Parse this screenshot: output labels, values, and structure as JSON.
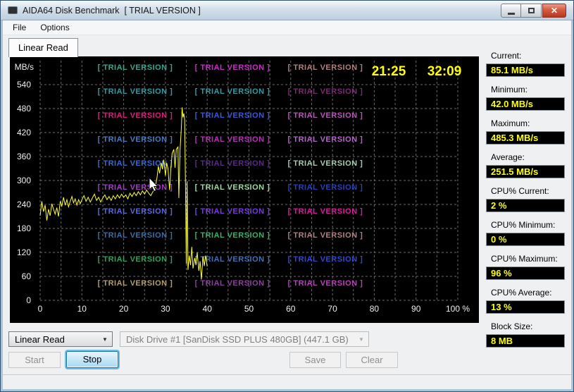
{
  "window": {
    "title": "AIDA64 Disk Benchmark  [ TRIAL VERSION ]"
  },
  "menu": {
    "items": [
      "File",
      "Options"
    ]
  },
  "tab": {
    "label": "Linear Read"
  },
  "chart_data": {
    "type": "line",
    "title": "",
    "ylabel": "MB/s",
    "xlabel": "",
    "ylim": [
      0,
      600
    ],
    "xlim": [
      0,
      100
    ],
    "y_ticks": [
      540,
      480,
      420,
      360,
      300,
      240,
      180,
      120,
      60,
      0
    ],
    "x_tick_labels": [
      "0",
      "10",
      "20",
      "30",
      "40",
      "50",
      "60",
      "70",
      "80",
      "90",
      "100 %"
    ],
    "x_grid_step_percent": 5,
    "grid": true,
    "legend": "none",
    "background": "#000000",
    "line_color": "#ffff2e",
    "elapsed_time": "21:25",
    "remaining_time": "32:09",
    "watermark_text": "[ TRIAL VERSION ]",
    "watermark_colors": [
      [
        "#38a88e",
        "#cc2acc",
        "#b57f7f"
      ],
      [
        "#2f9da5",
        "#2f9da5",
        "#7c2a72"
      ],
      [
        "#e01a7e",
        "#3a57d8",
        "#bb55bb"
      ],
      [
        "#4a7dc4",
        "#bb2ebb",
        "#b566c9"
      ],
      [
        "#3a6ad0",
        "#5a2a8a",
        "#a8ccb2"
      ],
      [
        "#a43cc9",
        "#9ed89e",
        "#2a3fbf"
      ],
      [
        "#5b68dd",
        "#7a3ae0",
        "#e018a0"
      ],
      [
        "#3e6da3",
        "#3cb06e",
        "#b08282"
      ],
      [
        "#2ca45c",
        "#4070b8",
        "#3347d2"
      ],
      [
        "#b3a06b",
        "#8f3f9f",
        "#bb3ebb"
      ]
    ],
    "series": [
      {
        "name": "Linear Read (MB/s)",
        "points": [
          [
            0,
            212
          ],
          [
            0.4,
            248
          ],
          [
            0.8,
            222
          ],
          [
            1.2,
            238
          ],
          [
            1.6,
            200
          ],
          [
            2,
            228
          ],
          [
            2.4,
            212
          ],
          [
            2.8,
            242
          ],
          [
            3.2,
            228
          ],
          [
            3.6,
            216
          ],
          [
            4,
            232
          ],
          [
            4.4,
            210
          ],
          [
            4.8,
            248
          ],
          [
            5.2,
            236
          ],
          [
            5.6,
            258
          ],
          [
            6,
            238
          ],
          [
            6.4,
            252
          ],
          [
            6.8,
            234
          ],
          [
            7.2,
            248
          ],
          [
            7.6,
            260
          ],
          [
            8,
            244
          ],
          [
            8.4,
            254
          ],
          [
            8.8,
            238
          ],
          [
            9.2,
            252
          ],
          [
            9.6,
            242
          ],
          [
            10,
            252
          ],
          [
            10.5,
            262
          ],
          [
            11,
            248
          ],
          [
            11.5,
            258
          ],
          [
            12,
            246
          ],
          [
            12.5,
            256
          ],
          [
            13,
            266
          ],
          [
            13.5,
            250
          ],
          [
            14,
            258
          ],
          [
            14.5,
            246
          ],
          [
            15,
            256
          ],
          [
            15.5,
            264
          ],
          [
            16,
            252
          ],
          [
            16.5,
            260
          ],
          [
            17,
            250
          ],
          [
            17.5,
            262
          ],
          [
            18,
            254
          ],
          [
            18.5,
            264
          ],
          [
            19,
            256
          ],
          [
            19.5,
            266
          ],
          [
            20,
            258
          ],
          [
            20.5,
            264
          ],
          [
            21,
            254
          ],
          [
            21.5,
            268
          ],
          [
            22,
            260
          ],
          [
            22.5,
            270
          ],
          [
            23,
            262
          ],
          [
            23.5,
            272
          ],
          [
            24,
            264
          ],
          [
            24.5,
            274
          ],
          [
            25,
            266
          ],
          [
            25.5,
            276
          ],
          [
            26,
            268
          ],
          [
            26.5,
            262
          ],
          [
            27,
            272
          ],
          [
            27.5,
            280
          ],
          [
            28,
            308
          ],
          [
            28.3,
            336
          ],
          [
            28.6,
            318
          ],
          [
            29,
            344
          ],
          [
            29.3,
            328
          ],
          [
            29.6,
            352
          ],
          [
            30,
            312
          ],
          [
            30.3,
            344
          ],
          [
            30.6,
            330
          ],
          [
            31,
            276
          ],
          [
            31.3,
            330
          ],
          [
            31.6,
            368
          ],
          [
            32,
            378
          ],
          [
            32.3,
            332
          ],
          [
            32.6,
            378
          ],
          [
            33,
            384
          ],
          [
            33.2,
            256
          ],
          [
            33.5,
            378
          ],
          [
            33.8,
            428
          ],
          [
            34,
            483
          ],
          [
            34.2,
            458
          ],
          [
            34.4,
            468
          ],
          [
            34.6,
            452
          ],
          [
            34.8,
            282
          ],
          [
            35,
            92
          ],
          [
            35.2,
            298
          ],
          [
            35.4,
            76
          ],
          [
            35.7,
            112
          ],
          [
            36,
            88
          ],
          [
            36.3,
            134
          ],
          [
            36.6,
            80
          ],
          [
            37,
            106
          ],
          [
            37.3,
            88
          ],
          [
            37.6,
            120
          ],
          [
            38,
            74
          ],
          [
            38.3,
            98
          ],
          [
            38.6,
            52
          ],
          [
            39,
            110
          ],
          [
            39.3,
            86
          ],
          [
            39.6,
            112
          ],
          [
            40,
            85
          ]
        ]
      }
    ]
  },
  "stats": [
    {
      "label": "Current:",
      "value": "85.1 MB/s"
    },
    {
      "label": "Minimum:",
      "value": "42.0 MB/s"
    },
    {
      "label": "Maximum:",
      "value": "485.3 MB/s"
    },
    {
      "label": "Average:",
      "value": "251.5 MB/s"
    },
    {
      "label": "CPU% Current:",
      "value": "2 %"
    },
    {
      "label": "CPU% Minimum:",
      "value": "0 %"
    },
    {
      "label": "CPU% Maximum:",
      "value": "96 %"
    },
    {
      "label": "CPU% Average:",
      "value": "13 %"
    },
    {
      "label": "Block Size:",
      "value": "8 MB"
    }
  ],
  "controls": {
    "benchmark_select": "Linear Read",
    "drive_select": "Disk Drive #1  [SanDisk SSD PLUS 480GB]  (447.1 GB)",
    "buttons": [
      {
        "label": "Start",
        "enabled": false
      },
      {
        "label": "Stop",
        "enabled": true
      },
      {
        "label": "Save",
        "enabled": false
      },
      {
        "label": "Clear",
        "enabled": false
      }
    ]
  }
}
